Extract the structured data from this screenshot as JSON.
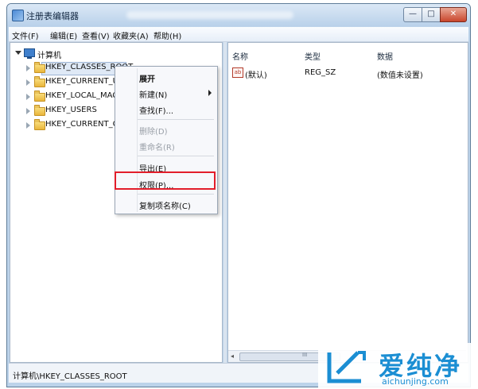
{
  "window": {
    "title": "注册表编辑器",
    "caption_buttons": {
      "minimize": "—",
      "maximize": "□",
      "close": "✕"
    }
  },
  "menubar": [
    "文件(F)",
    "编辑(E)",
    "查看(V)",
    "收藏夹(A)",
    "帮助(H)"
  ],
  "tree": {
    "root": "计算机",
    "nodes": [
      "HKEY_CLASSES_ROOT",
      "HKEY_CURRENT_USER",
      "HKEY_LOCAL_MACHINE",
      "HKEY_USERS",
      "HKEY_CURRENT_CONFIG"
    ]
  },
  "list": {
    "columns": [
      "名称",
      "类型",
      "数据"
    ],
    "rows": [
      {
        "name": "(默认)",
        "type": "REG_SZ",
        "data": "(数值未设置)",
        "icon": "ab"
      }
    ]
  },
  "context_menu": {
    "items": [
      "展开",
      "新建(N)",
      "查找(F)...",
      "删除(D)",
      "重命名(R)",
      "导出(E)",
      "权限(P)...",
      "复制项名称(C)"
    ],
    "highlighted": "权限(P)...",
    "highlight_color": "#e21d2a"
  },
  "scrollbar": {
    "left_arrow": "◂",
    "grip": "III"
  },
  "status": "计算机\\HKEY_CLASSES_ROOT",
  "watermark": {
    "cn": "爱纯净",
    "url": "aichunjing.com",
    "color": "#1b8ed3"
  }
}
